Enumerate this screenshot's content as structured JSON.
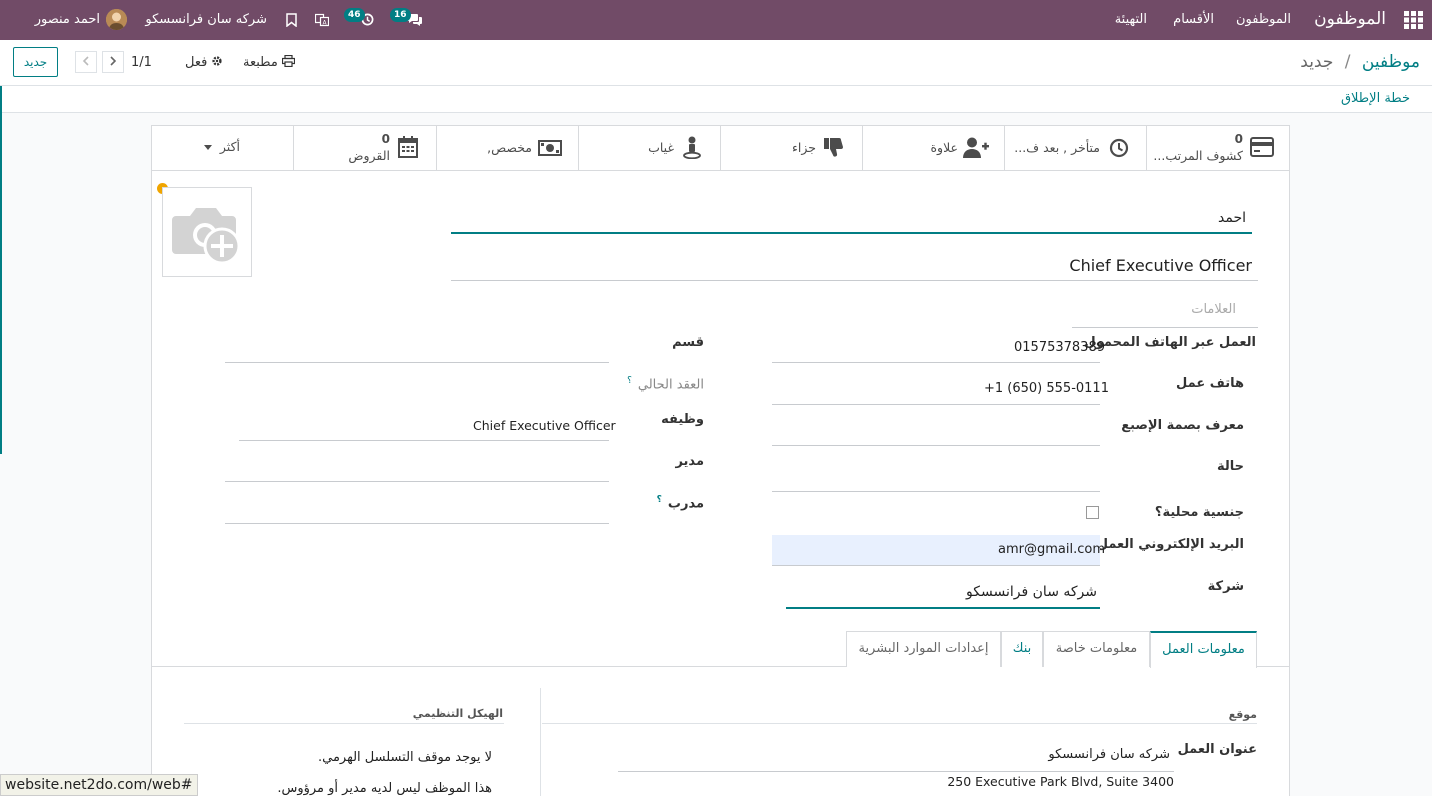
{
  "navbar": {
    "app_title": "الموظفون",
    "menu": [
      "الموظفون",
      "الأقسام",
      "التهيئة"
    ],
    "messages_count": "16",
    "activities_count": "46",
    "company": "شركه سان فرانسسكو",
    "user": "احمد منصور"
  },
  "control_panel": {
    "breadcrumb_parent": "موظفين",
    "breadcrumb_separator": "/",
    "breadcrumb_current": "جديد",
    "print_label": "مطبعة",
    "action_label": "فعل",
    "pager": "1/1",
    "new_button": "جديد"
  },
  "status": {
    "launch_plan": "خطة الإطلاق"
  },
  "smart_buttons": [
    {
      "label": "كشوف المرتب...",
      "count": "0",
      "icon": "credit-card-icon"
    },
    {
      "label": "متأخر , بعد ف...",
      "icon": "clock-icon"
    },
    {
      "label": "علاوة",
      "icon": "user-plus-icon"
    },
    {
      "label": "جزاء",
      "icon": "thumbs-down-icon"
    },
    {
      "label": "غياب",
      "icon": "user-location-icon"
    },
    {
      "label": "مخصص,",
      "icon": "money-icon"
    },
    {
      "label": "القروض",
      "count": "0",
      "icon": "calendar-icon"
    },
    {
      "label": "أكثر",
      "icon": "caret-down-icon"
    }
  ],
  "employee": {
    "name": "احمد",
    "job_title": "Chief Executive Officer",
    "tags_placeholder": "العلامات"
  },
  "fields_right": [
    {
      "label": "العمل عبر الهاتف المحمول",
      "value": "01575378389"
    },
    {
      "label": "هاتف عمل",
      "value": "+1 (650) 555-0111"
    },
    {
      "label": "معرف بصمة الإصبع",
      "value": ""
    },
    {
      "label": "حالة",
      "value": ""
    },
    {
      "label": "جنسية محلية؟",
      "value": ""
    },
    {
      "label": "البريد الإلكتروني العمل",
      "value": "amr@gmail.com"
    },
    {
      "label": "شركة",
      "value": "شركه سان فرانسسكو"
    }
  ],
  "fields_left": [
    {
      "label": "قسم",
      "value": ""
    },
    {
      "label": "العقد الحالي",
      "value": ""
    },
    {
      "label": "وظيفه",
      "value": "Chief Executive Officer"
    },
    {
      "label": "مدير",
      "value": ""
    },
    {
      "label": "مدرب",
      "value": ""
    }
  ],
  "help_mark": "؟",
  "tabs": [
    "معلومات العمل",
    "معلومات خاصة",
    "بنك",
    "إعدادات الموارد البشرية"
  ],
  "work_info": {
    "location_section": "موقع",
    "work_address_label": "عنوان العمل",
    "work_address_value": "شركه سان فرانسسكو",
    "address_line": "250 Executive Park Blvd, Suite 3400",
    "org_chart_title": "الهيكل التنظيمي",
    "org_line1": "لا يوجد موقف التسلسل الهرمي.",
    "org_line2": "هذا الموظف ليس لديه مدير أو مرؤوس."
  },
  "url_tooltip": "website.net2do.com/web#",
  "colors": {
    "navbar": "#714b67",
    "accent": "#017e84",
    "alert_dot": "#f0a500"
  }
}
